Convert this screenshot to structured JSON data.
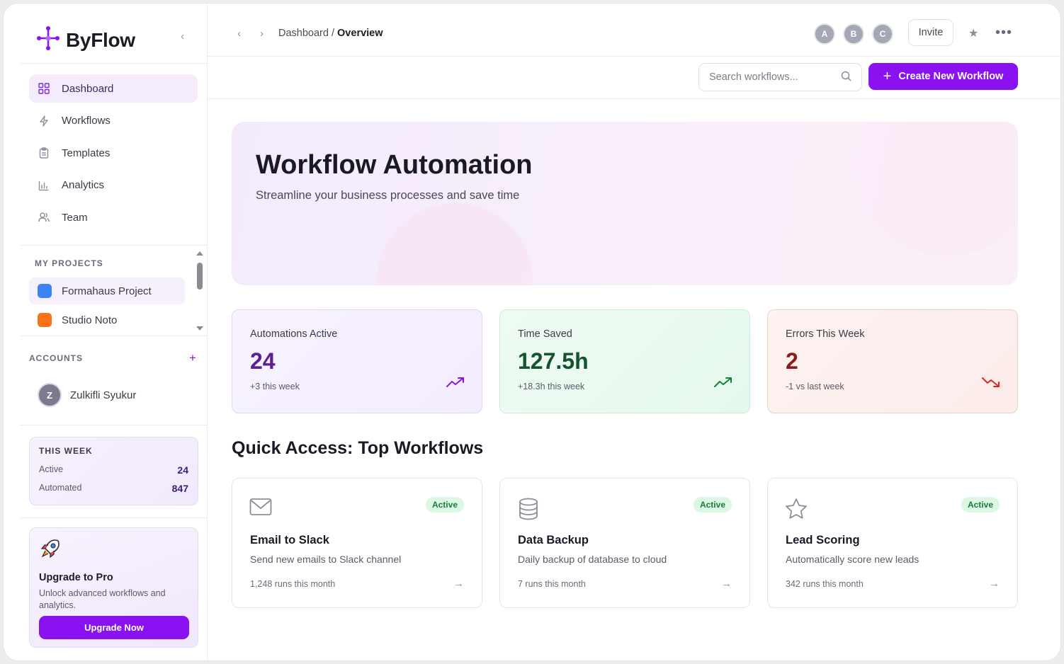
{
  "brand": {
    "name": "ByFlow"
  },
  "topbar": {
    "breadcrumb_parent": "Dashboard /",
    "breadcrumb_current": "Overview",
    "avatars": [
      "A",
      "B",
      "C"
    ],
    "invite_label": "Invite"
  },
  "toolbar": {
    "search_placeholder": "Search workflows...",
    "create_label": "Create New Workflow"
  },
  "sidebar": {
    "nav": [
      {
        "label": "Dashboard",
        "icon": "grid-icon"
      },
      {
        "label": "Workflows",
        "icon": "bolt-icon"
      },
      {
        "label": "Templates",
        "icon": "clipboard-icon"
      },
      {
        "label": "Analytics",
        "icon": "bar-chart-icon"
      },
      {
        "label": "Team",
        "icon": "users-icon"
      }
    ],
    "projects_label": "MY PROJECTS",
    "projects": [
      {
        "label": "Formahaus Project",
        "color": "#3b82f6"
      },
      {
        "label": "Studio Noto",
        "color": "#f97316"
      }
    ],
    "accounts_label": "ACCOUNTS",
    "account": {
      "initial": "Z",
      "name": "Zulkifli Syukur"
    },
    "week": {
      "title": "THIS WEEK",
      "active_label": "Active",
      "active_value": "24",
      "automated_label": "Automated",
      "automated_value": "847"
    },
    "upgrade": {
      "title": "Upgrade to Pro",
      "desc": "Unlock advanced workflows and analytics.",
      "button": "Upgrade Now"
    }
  },
  "hero": {
    "title": "Workflow Automation",
    "subtitle": "Streamline your business processes and save time"
  },
  "stats": [
    {
      "label": "Automations Active",
      "value": "24",
      "change": "+3 this week",
      "color": "#5b1e96",
      "trend": "up"
    },
    {
      "label": "Time Saved",
      "value": "127.5h",
      "change": "+18.3h this week",
      "color": "#14532d",
      "trend": "up"
    },
    {
      "label": "Errors This Week",
      "value": "2",
      "change": "-1 vs last week",
      "color": "#8b1c1c",
      "trend": "down"
    }
  ],
  "quick_access": {
    "title": "Quick Access: Top Workflows",
    "items": [
      {
        "icon": "mail-icon",
        "badge": "Active",
        "title": "Email to Slack",
        "desc": "Send new emails to Slack channel",
        "runs": "1,248 runs this month"
      },
      {
        "icon": "database-icon",
        "badge": "Active",
        "title": "Data Backup",
        "desc": "Daily backup of database to cloud",
        "runs": "7 runs this month"
      },
      {
        "icon": "star-icon",
        "badge": "Active",
        "title": "Lead Scoring",
        "desc": "Automatically score new leads",
        "runs": "342 runs this month"
      }
    ]
  }
}
